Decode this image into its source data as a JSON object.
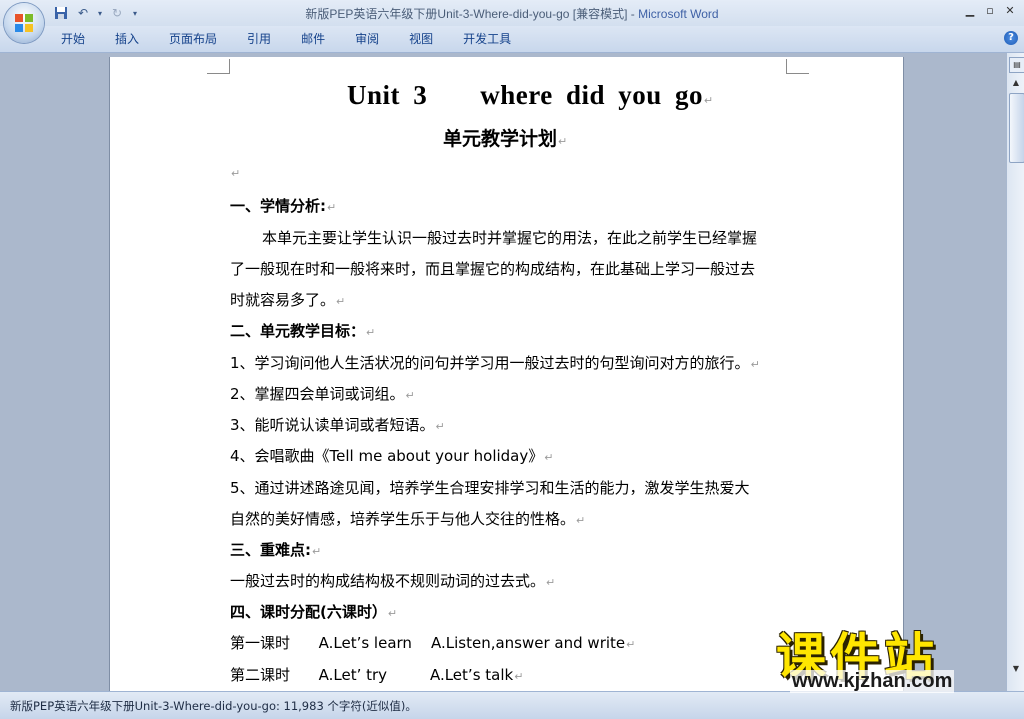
{
  "window": {
    "title": "新版PEP英语六年级下册Unit-3-Where-did-you-go [兼容模式] - ",
    "app_name": "Microsoft Word"
  },
  "qat": {
    "save_icon": "save-icon",
    "undo_icon": "undo-icon",
    "redo_icon": "redo-icon"
  },
  "ribbon": {
    "tabs": [
      "开始",
      "插入",
      "页面布局",
      "引用",
      "邮件",
      "审阅",
      "视图",
      "开发工具"
    ]
  },
  "document": {
    "title": "Unit 3    where did you go",
    "subtitle": "单元教学计划",
    "sections": [
      {
        "text": "一、学情分析:",
        "bold": true
      },
      {
        "text": "本单元主要让学生认识一般过去时并掌握它的用法，在此之前学生已经掌握"
      },
      {
        "text": "了一般现在时和一般将来时，而且掌握它的构成结构，在此基础上学习一般过去"
      },
      {
        "text": "时就容易多了。"
      },
      {
        "text": "二、单元教学目标：",
        "bold": true
      },
      {
        "text": "1、学习询问他人生活状况的问句并学习用一般过去时的句型询问对方的旅行。"
      },
      {
        "text": "2、掌握四会单词或词组。"
      },
      {
        "text": "3、能听说认读单词或者短语。"
      },
      {
        "text": "4、会唱歌曲《Tell me about your holiday》"
      },
      {
        "text": "5、通过讲述路途见闻，培养学生合理安排学习和生活的能力，激发学生热爱大"
      },
      {
        "text": "自然的美好情感，培养学生乐于与他人交往的性格。"
      },
      {
        "text": "三、重难点:",
        "bold": true
      },
      {
        "text": "一般过去时的构成结构极不规则动词的过去式。"
      },
      {
        "text": "四、课时分配(六课时）",
        "bold": true
      },
      {
        "text": "第一课时      A.Let’s learn    A.Listen,answer and write"
      },
      {
        "text": "第二课时      A.Let’ try         A.Let’s talk"
      }
    ]
  },
  "statusbar": {
    "text": "新版PEP英语六年级下册Unit-3-Where-did-you-go: 11,983 个字符(近似值)。"
  },
  "watermark": {
    "brand": "课件站",
    "url": "www.kjzhan.com"
  },
  "colors": {
    "ribbon_text": "#15428b",
    "workspace": "#abb8cc",
    "watermark": "#ffe600"
  }
}
